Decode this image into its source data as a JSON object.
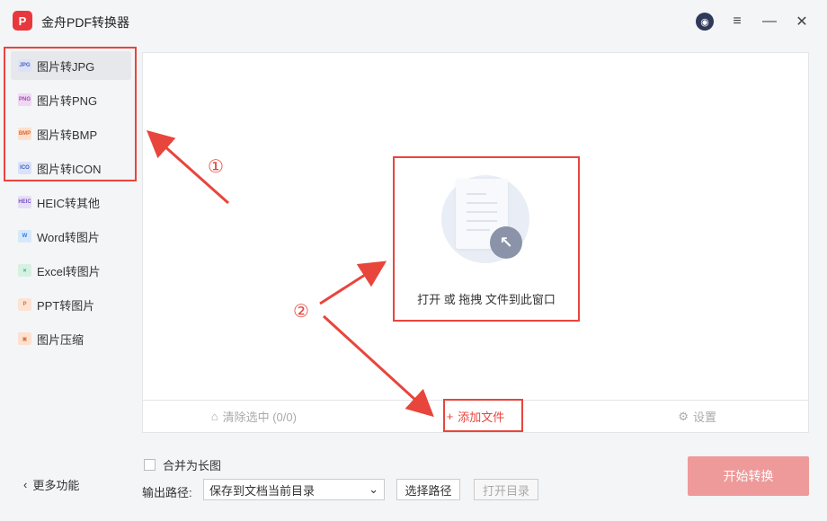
{
  "app": {
    "title": "金舟PDF转换器",
    "logo_text": "P"
  },
  "window": {
    "menu": "≡",
    "minimize": "—",
    "close": "✕"
  },
  "sidebar": {
    "items": [
      {
        "label": "图片转JPG",
        "icon_text": "JPG",
        "icon_bg": "#dde3f7",
        "icon_color": "#4a5fc1"
      },
      {
        "label": "图片转PNG",
        "icon_text": "PNG",
        "icon_bg": "#efd8f2",
        "icon_color": "#a34bb5"
      },
      {
        "label": "图片转BMP",
        "icon_text": "BMP",
        "icon_bg": "#fde0cf",
        "icon_color": "#e0672f"
      },
      {
        "label": "图片转ICON",
        "icon_text": "ICO",
        "icon_bg": "#d9e2f8",
        "icon_color": "#3f5ec2"
      },
      {
        "label": "HEIC转其他",
        "icon_text": "HEIC",
        "icon_bg": "#e6def6",
        "icon_color": "#7a55c8"
      },
      {
        "label": "Word转图片",
        "icon_text": "W",
        "icon_bg": "#d8e8fb",
        "icon_color": "#2b7fe0"
      },
      {
        "label": "Excel转图片",
        "icon_text": "✕",
        "icon_bg": "#d6f1e3",
        "icon_color": "#1e9b5a"
      },
      {
        "label": "PPT转图片",
        "icon_text": "P",
        "icon_bg": "#fde3d4",
        "icon_color": "#e66a2c"
      },
      {
        "label": "图片压缩",
        "icon_text": "▣",
        "icon_bg": "#fde1d0",
        "icon_color": "#e4703a"
      }
    ],
    "more": "更多功能"
  },
  "dropzone": {
    "text": "打开 或 拖拽 文件到此窗口"
  },
  "actionbar": {
    "clear": "清除选中 (0/0)",
    "add": "添加文件",
    "settings": "设置"
  },
  "bottom": {
    "merge": "合并为长图",
    "path_label": "输出路径:",
    "path_value": "保存到文档当前目录",
    "choose_path": "选择路径",
    "open_dir": "打开目录",
    "start": "开始转换"
  },
  "annotations": {
    "marker1": "①",
    "marker2": "②"
  },
  "colors": {
    "accent": "#e8453c",
    "start_button": "#ee9a9a"
  }
}
